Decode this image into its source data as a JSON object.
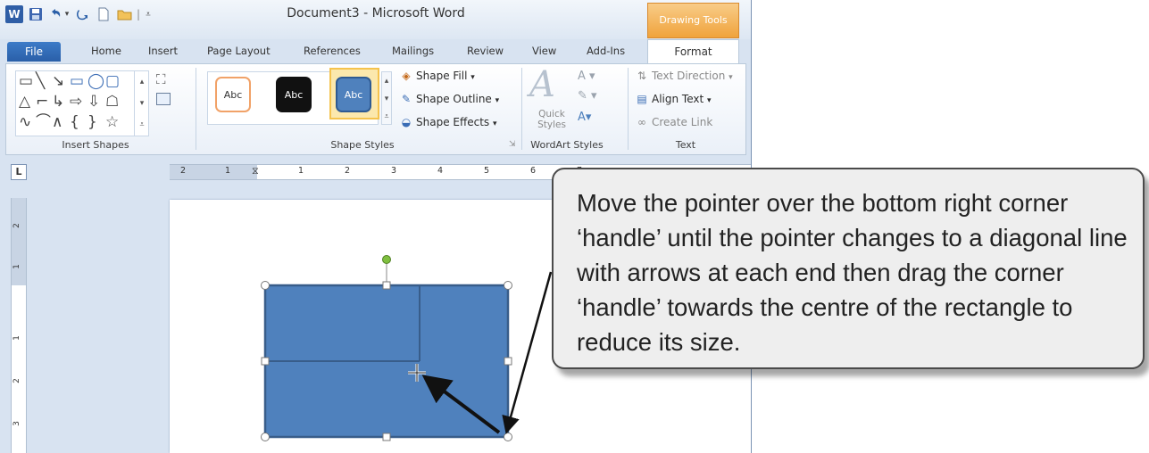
{
  "window": {
    "title": "Document3 - Microsoft Word",
    "context_header": "Drawing Tools"
  },
  "quick_access": {
    "icons": [
      "word-logo-icon",
      "save-icon",
      "undo-icon",
      "redo-icon",
      "new-document-icon",
      "open-folder-icon",
      "customize-toolbar-icon"
    ],
    "word_logo": "W"
  },
  "tabs": {
    "file": "File",
    "home": "Home",
    "insert": "Insert",
    "page_layout": "Page Layout",
    "references": "References",
    "mailings": "Mailings",
    "review": "Review",
    "view": "View",
    "add_ins": "Add-Ins",
    "format": "Format"
  },
  "ribbon": {
    "insert_shapes": {
      "label": "Insert Shapes",
      "glyphs": [
        "▭",
        "╲",
        "╲",
        "▢",
        "◯",
        "▢",
        "△",
        "⌐",
        "⌐",
        "⇨",
        "⇩",
        "☖",
        "∿",
        "⌒",
        "∧",
        "{",
        "}",
        "☆"
      ]
    },
    "shape_styles": {
      "label": "Shape Styles",
      "previews": [
        "Abc",
        "Abc",
        "Abc"
      ],
      "commands": {
        "fill": "Shape Fill",
        "outline": "Shape Outline",
        "effects": "Shape Effects"
      }
    },
    "wordart_styles": {
      "label": "WordArt Styles",
      "quick_styles": "Quick Styles",
      "letter": "A"
    },
    "text": {
      "label": "Text",
      "commands": {
        "direction": "Text Direction",
        "align": "Align Text",
        "link": "Create Link"
      }
    }
  },
  "ruler": {
    "tab_selector": "L",
    "h_numbers": [
      "2",
      "1",
      "1",
      "2",
      "3",
      "4",
      "5",
      "6",
      "7"
    ],
    "v_numbers": [
      "2",
      "1",
      "1",
      "2",
      "3"
    ]
  },
  "callout": {
    "text": "Move the pointer over the bottom right corner ‘handle’ until the pointer changes to a diagonal line with arrows at each end then drag the corner ‘handle’ towards the centre of the rectangle to reduce its size."
  },
  "colors": {
    "ribbon_bg": "#eaf0f8",
    "title_bg": "#dde7f3",
    "accent_blue": "#2a5fa8",
    "context_orange": "#f0a33c",
    "shape_fill": "#4f81bd",
    "shape_outline": "#385d8a",
    "rotate_handle": "#7fbf3f"
  }
}
